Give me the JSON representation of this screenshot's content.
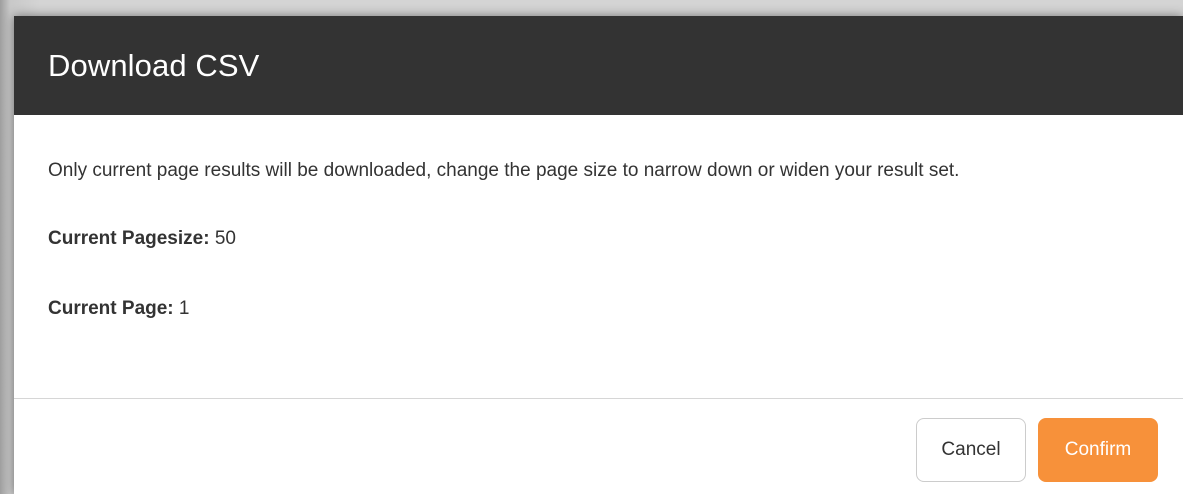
{
  "dialog": {
    "title": "Download CSV",
    "message": "Only current page results will be downloaded, change the page size to narrow down or widen your result set.",
    "pagesize": {
      "label": "Current Pagesize:",
      "value": "50"
    },
    "page": {
      "label": "Current Page:",
      "value": "1"
    },
    "buttons": {
      "cancel_label": "Cancel",
      "confirm_label": "Confirm"
    }
  },
  "colors": {
    "header_bg": "#333333",
    "confirm_bg": "#f7913a",
    "text": "#333333"
  }
}
